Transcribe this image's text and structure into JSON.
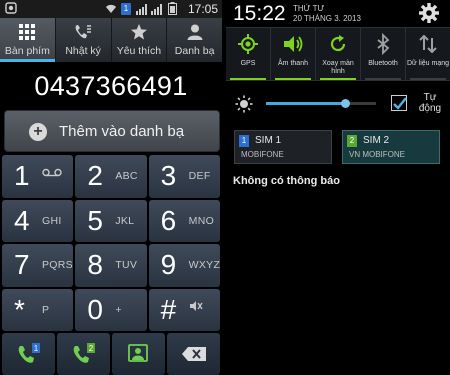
{
  "dialer": {
    "status_bar": {
      "time": "17:05",
      "sim_badge": "1"
    },
    "tabs": [
      {
        "label": "Bàn phím",
        "icon": "keypad-icon",
        "active": true
      },
      {
        "label": "Nhật ký",
        "icon": "call-log-icon",
        "active": false
      },
      {
        "label": "Yêu thích",
        "icon": "star-icon",
        "active": false
      },
      {
        "label": "Danh bạ",
        "icon": "contacts-icon",
        "active": false
      }
    ],
    "number": "0437366491",
    "add_contact_label": "Thêm vào danh bạ",
    "keys": [
      {
        "digit": "1",
        "letters": ""
      },
      {
        "digit": "2",
        "letters": "ABC"
      },
      {
        "digit": "3",
        "letters": "DEF"
      },
      {
        "digit": "4",
        "letters": "GHI"
      },
      {
        "digit": "5",
        "letters": "JKL"
      },
      {
        "digit": "6",
        "letters": "MNO"
      },
      {
        "digit": "7",
        "letters": "PQRS"
      },
      {
        "digit": "8",
        "letters": "TUV"
      },
      {
        "digit": "9",
        "letters": "WXYZ"
      },
      {
        "digit": "*",
        "letters": "P"
      },
      {
        "digit": "0",
        "letters": "+"
      },
      {
        "digit": "#",
        "letters": ""
      }
    ],
    "actions": [
      {
        "icon": "call-sim1-icon",
        "badge": "1"
      },
      {
        "icon": "call-sim2-icon",
        "badge": "2"
      },
      {
        "icon": "add-contact-icon"
      },
      {
        "icon": "backspace-icon"
      }
    ]
  },
  "shade": {
    "time": "15:22",
    "day": "THỨ TƯ",
    "date": "20 THÁNG 3. 2013",
    "quick_settings": [
      {
        "label": "GPS",
        "icon": "gps-icon",
        "on": true
      },
      {
        "label": "Âm thanh",
        "icon": "sound-icon",
        "on": true
      },
      {
        "label": "Xoay màn hình",
        "icon": "rotate-icon",
        "on": true
      },
      {
        "label": "Bluetooth",
        "icon": "bluetooth-icon",
        "on": false
      },
      {
        "label": "Dữ liệu mạng",
        "icon": "mobile-data-icon",
        "on": false
      }
    ],
    "brightness_level": 0.72,
    "auto_label": "Tự động",
    "auto_checked": true,
    "sims": [
      {
        "badge": "1",
        "name": "SIM 1",
        "carrier": "MOBIFONE"
      },
      {
        "badge": "2",
        "name": "SIM 2",
        "carrier": "VN MOBIFONE"
      }
    ],
    "no_notifications": "Không có thông báo"
  },
  "colors": {
    "accent_blue": "#4fb3e8",
    "toggle_on": "#7ed321",
    "sim1": "#2c6fd0",
    "sim2": "#5aa832"
  }
}
